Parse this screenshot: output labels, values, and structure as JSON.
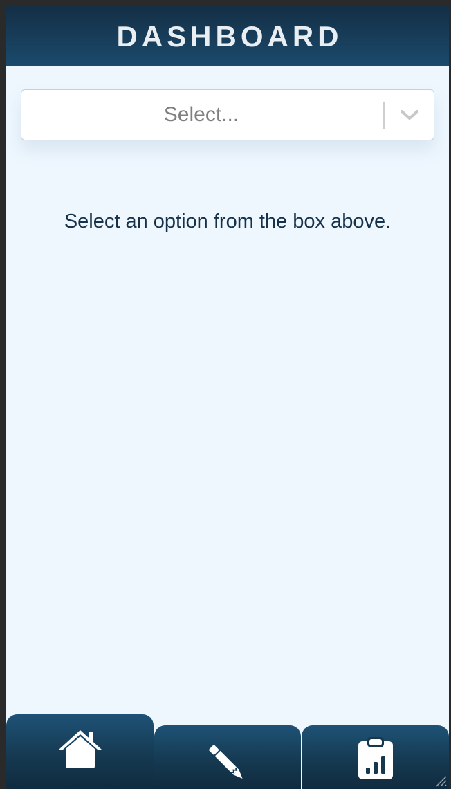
{
  "header": {
    "title": "DASHBOARD"
  },
  "select": {
    "placeholder": "Select...",
    "icon": "chevron-down-icon"
  },
  "main": {
    "hint": "Select an option from the box above."
  },
  "tabs": [
    {
      "icon": "home-icon",
      "active": true
    },
    {
      "icon": "pencil-icon",
      "active": false
    },
    {
      "icon": "clipboard-chart-icon",
      "active": false
    }
  ],
  "colors": {
    "header_top": "#142f46",
    "header_bottom": "#1b4a6c",
    "background": "#eef7fe",
    "text": "#16324a",
    "placeholder": "#7f7f7f"
  }
}
